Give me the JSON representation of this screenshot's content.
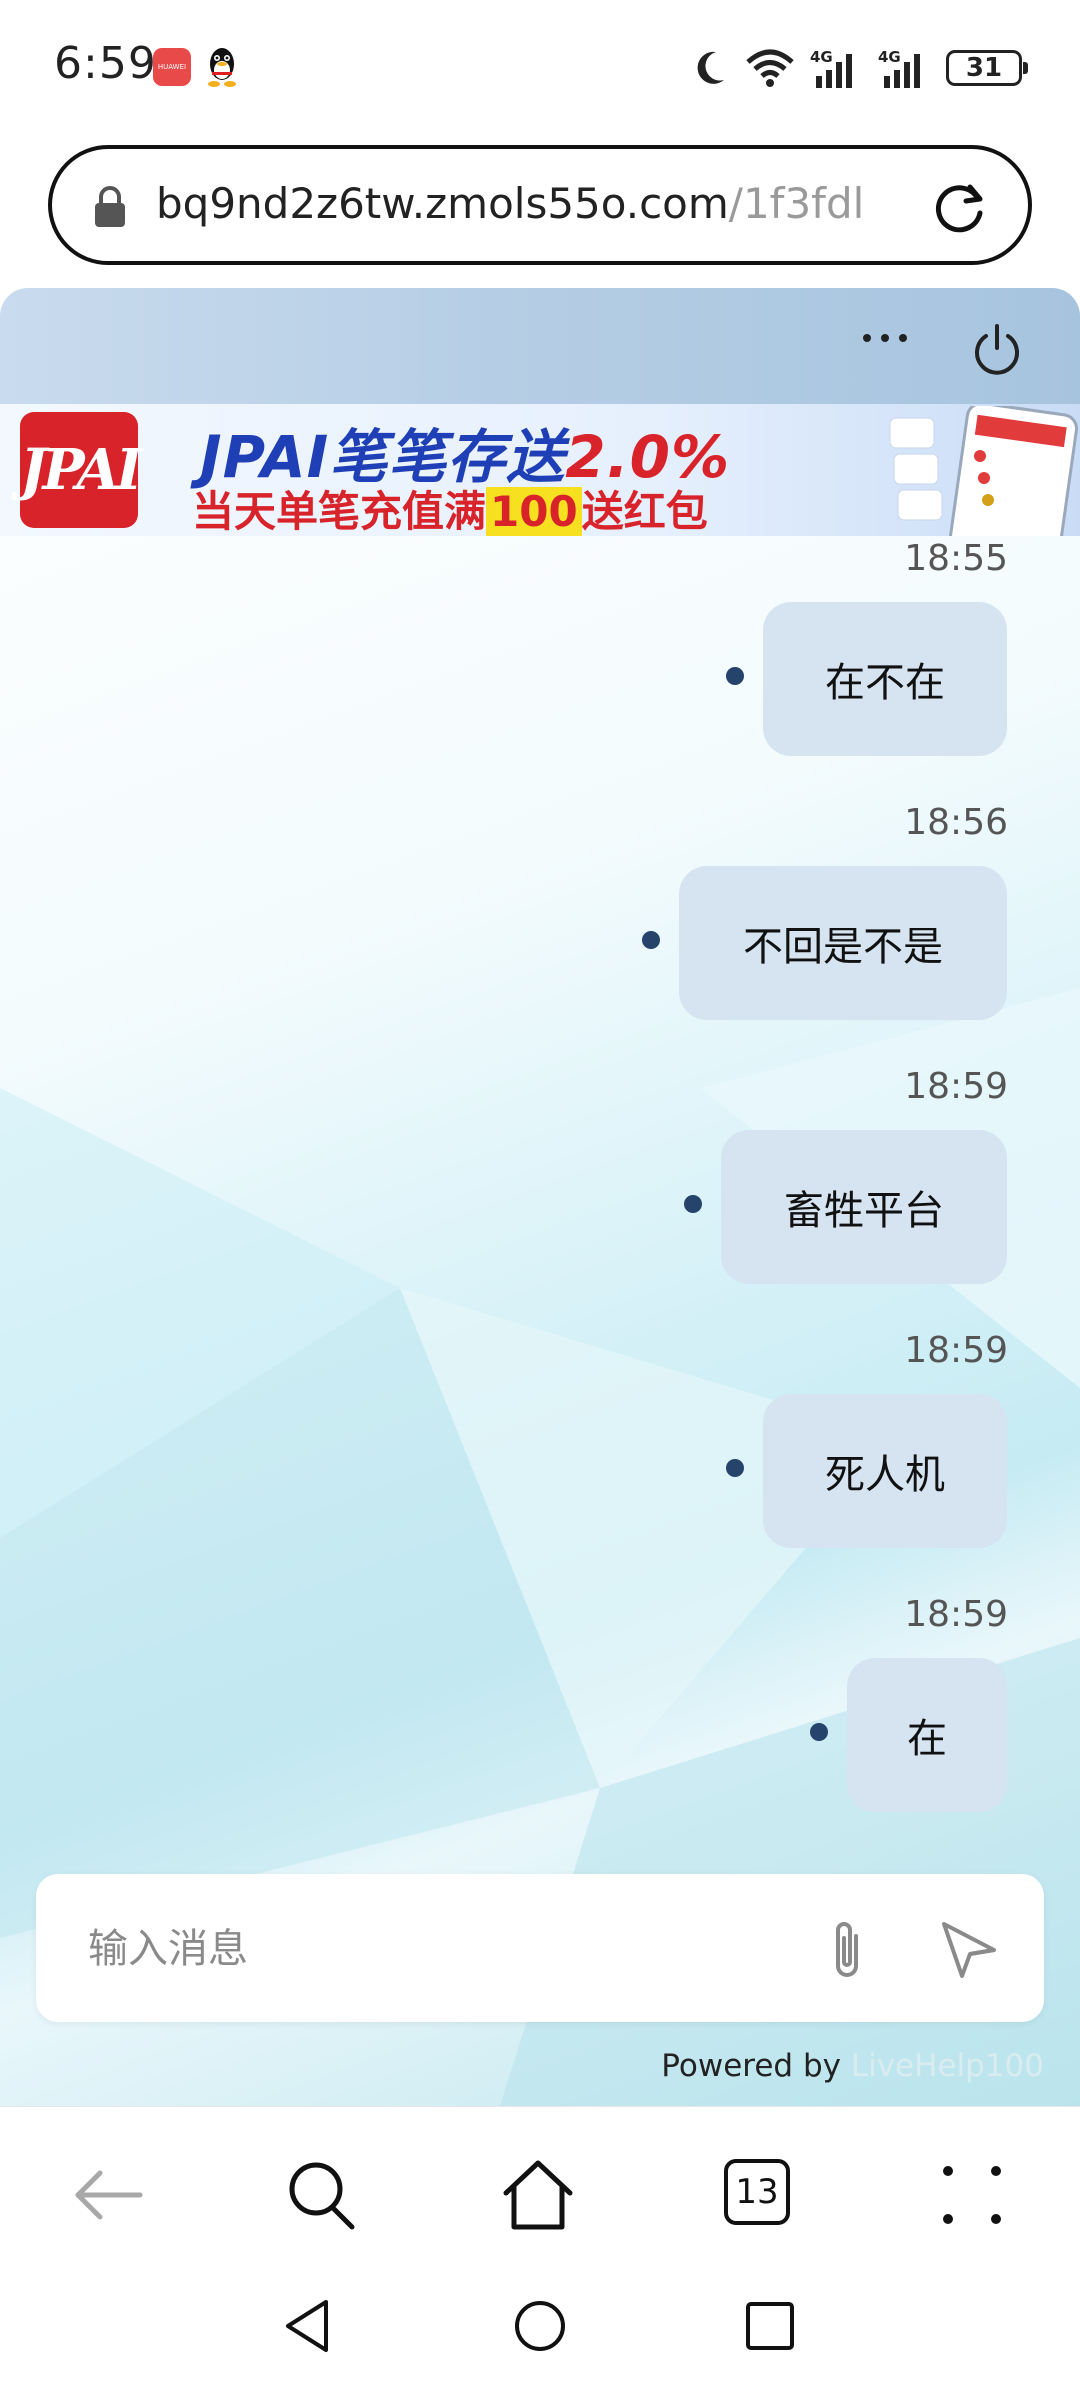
{
  "status_bar": {
    "time": "6:59",
    "app_badge_text": "HUAWEI",
    "battery": "31"
  },
  "url_bar": {
    "domain": "bq9nd2z6tw.zmols55o.com",
    "path": "/1f3fdl"
  },
  "banner": {
    "logo_text": "JPAI",
    "headline": "JPAI笔笔存送",
    "headline_percent": "2.0%",
    "subline_pre": "当天单笔充值满",
    "subline_amount": "100",
    "subline_post": "送红包"
  },
  "messages": [
    {
      "time": "18:55",
      "text": "在不在"
    },
    {
      "time": "18:56",
      "text": "不回是不是"
    },
    {
      "time": "18:59",
      "text": "畜牲平台"
    },
    {
      "time": "18:59",
      "text": "死人机"
    },
    {
      "time": "18:59",
      "text": "在"
    }
  ],
  "input": {
    "placeholder": "输入消息"
  },
  "footer": {
    "powered_label": "Powered by",
    "brand": "LiveHelp100"
  },
  "toolbar": {
    "tab_count": "13"
  },
  "colors": {
    "bubble": "#d6e4f2",
    "dot": "#26446b",
    "banner_blue": "#1f3fb6",
    "banner_red": "#d8232a"
  }
}
